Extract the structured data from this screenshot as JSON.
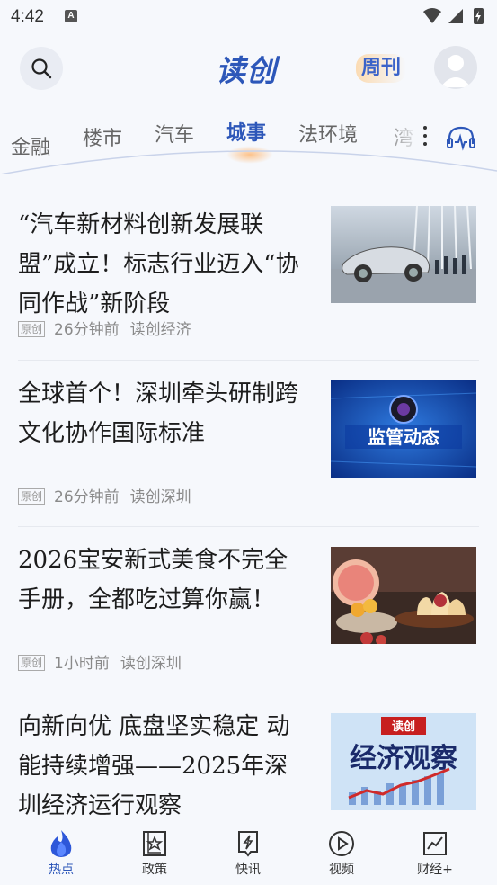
{
  "status_bar": {
    "time": "4:42",
    "notification_icon": "A"
  },
  "header": {
    "logo": "读创",
    "weekly": "周刊"
  },
  "tabs": [
    {
      "label": "金融"
    },
    {
      "label": "楼市"
    },
    {
      "label": "汽车"
    },
    {
      "label": "城事"
    },
    {
      "label": "法环境"
    },
    {
      "label": "湾"
    }
  ],
  "active_tab": "城事",
  "articles": [
    {
      "title": "“汽车新材料创新发展联盟”成立！标志行业迈入“协同作战”新阶段",
      "badge": "原创",
      "time": "26分钟前",
      "source": "读创经济",
      "thumb": "car-exhibition-photo"
    },
    {
      "title": "全球首个！深圳牵头研制跨文化协作国际标准",
      "badge": "原创",
      "time": "26分钟前",
      "source": "读创深圳",
      "thumb": "监管动态"
    },
    {
      "title": "2026宝安新式美食不完全手册，全都吃过算你赢！",
      "badge": "原创",
      "time": "1小时前",
      "source": "读创深圳",
      "thumb": "pastries-photo"
    },
    {
      "title": "向新向优 底盘坚实稳定 动能持续增强——2025年深圳经济运行观察",
      "thumb_tag": "读创",
      "thumb_title": "经济观察"
    }
  ],
  "bottom_nav": [
    {
      "label": "热点",
      "icon": "flame-icon",
      "active": true
    },
    {
      "label": "政策",
      "icon": "policy-icon",
      "active": false
    },
    {
      "label": "快讯",
      "icon": "flash-icon",
      "active": false
    },
    {
      "label": "视频",
      "icon": "play-icon",
      "active": false
    },
    {
      "label": "财经+",
      "icon": "chart-icon",
      "active": false
    }
  ],
  "colors": {
    "accent": "#2d57b9",
    "background": "#f6f8fc",
    "glow": "#ffb064"
  }
}
